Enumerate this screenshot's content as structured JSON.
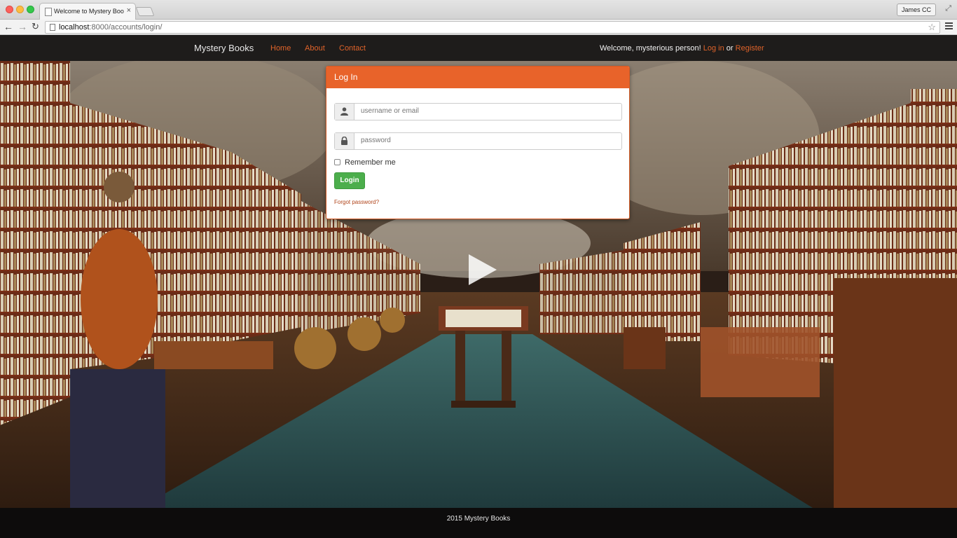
{
  "browser": {
    "tab_title": "Welcome to Mystery Books",
    "tab_close": "×",
    "profile": "James CC",
    "url_host": "localhost",
    "url_rest": ":8000/accounts/login/",
    "icons": [
      "back-icon",
      "forward-icon",
      "reload-icon",
      "star-icon",
      "menu-icon",
      "fullscreen-icon"
    ]
  },
  "navbar": {
    "brand": "Mystery Books",
    "links": [
      "Home",
      "About",
      "Contact"
    ],
    "welcome_prefix": "Welcome, mysterious person!",
    "login_link": "Log in",
    "or": "or",
    "register_link": "Register"
  },
  "login_panel": {
    "title": "Log In",
    "username_placeholder": "username or email",
    "password_placeholder": "password",
    "remember_label": "Remember me",
    "submit_label": "Login",
    "forgot_link": "Forgot password?"
  },
  "footer": {
    "text": "2015 Mystery Books"
  },
  "colors": {
    "accent": "#e8632a",
    "success": "#4cae4c",
    "navbar_bg": "#1e1c1c"
  }
}
